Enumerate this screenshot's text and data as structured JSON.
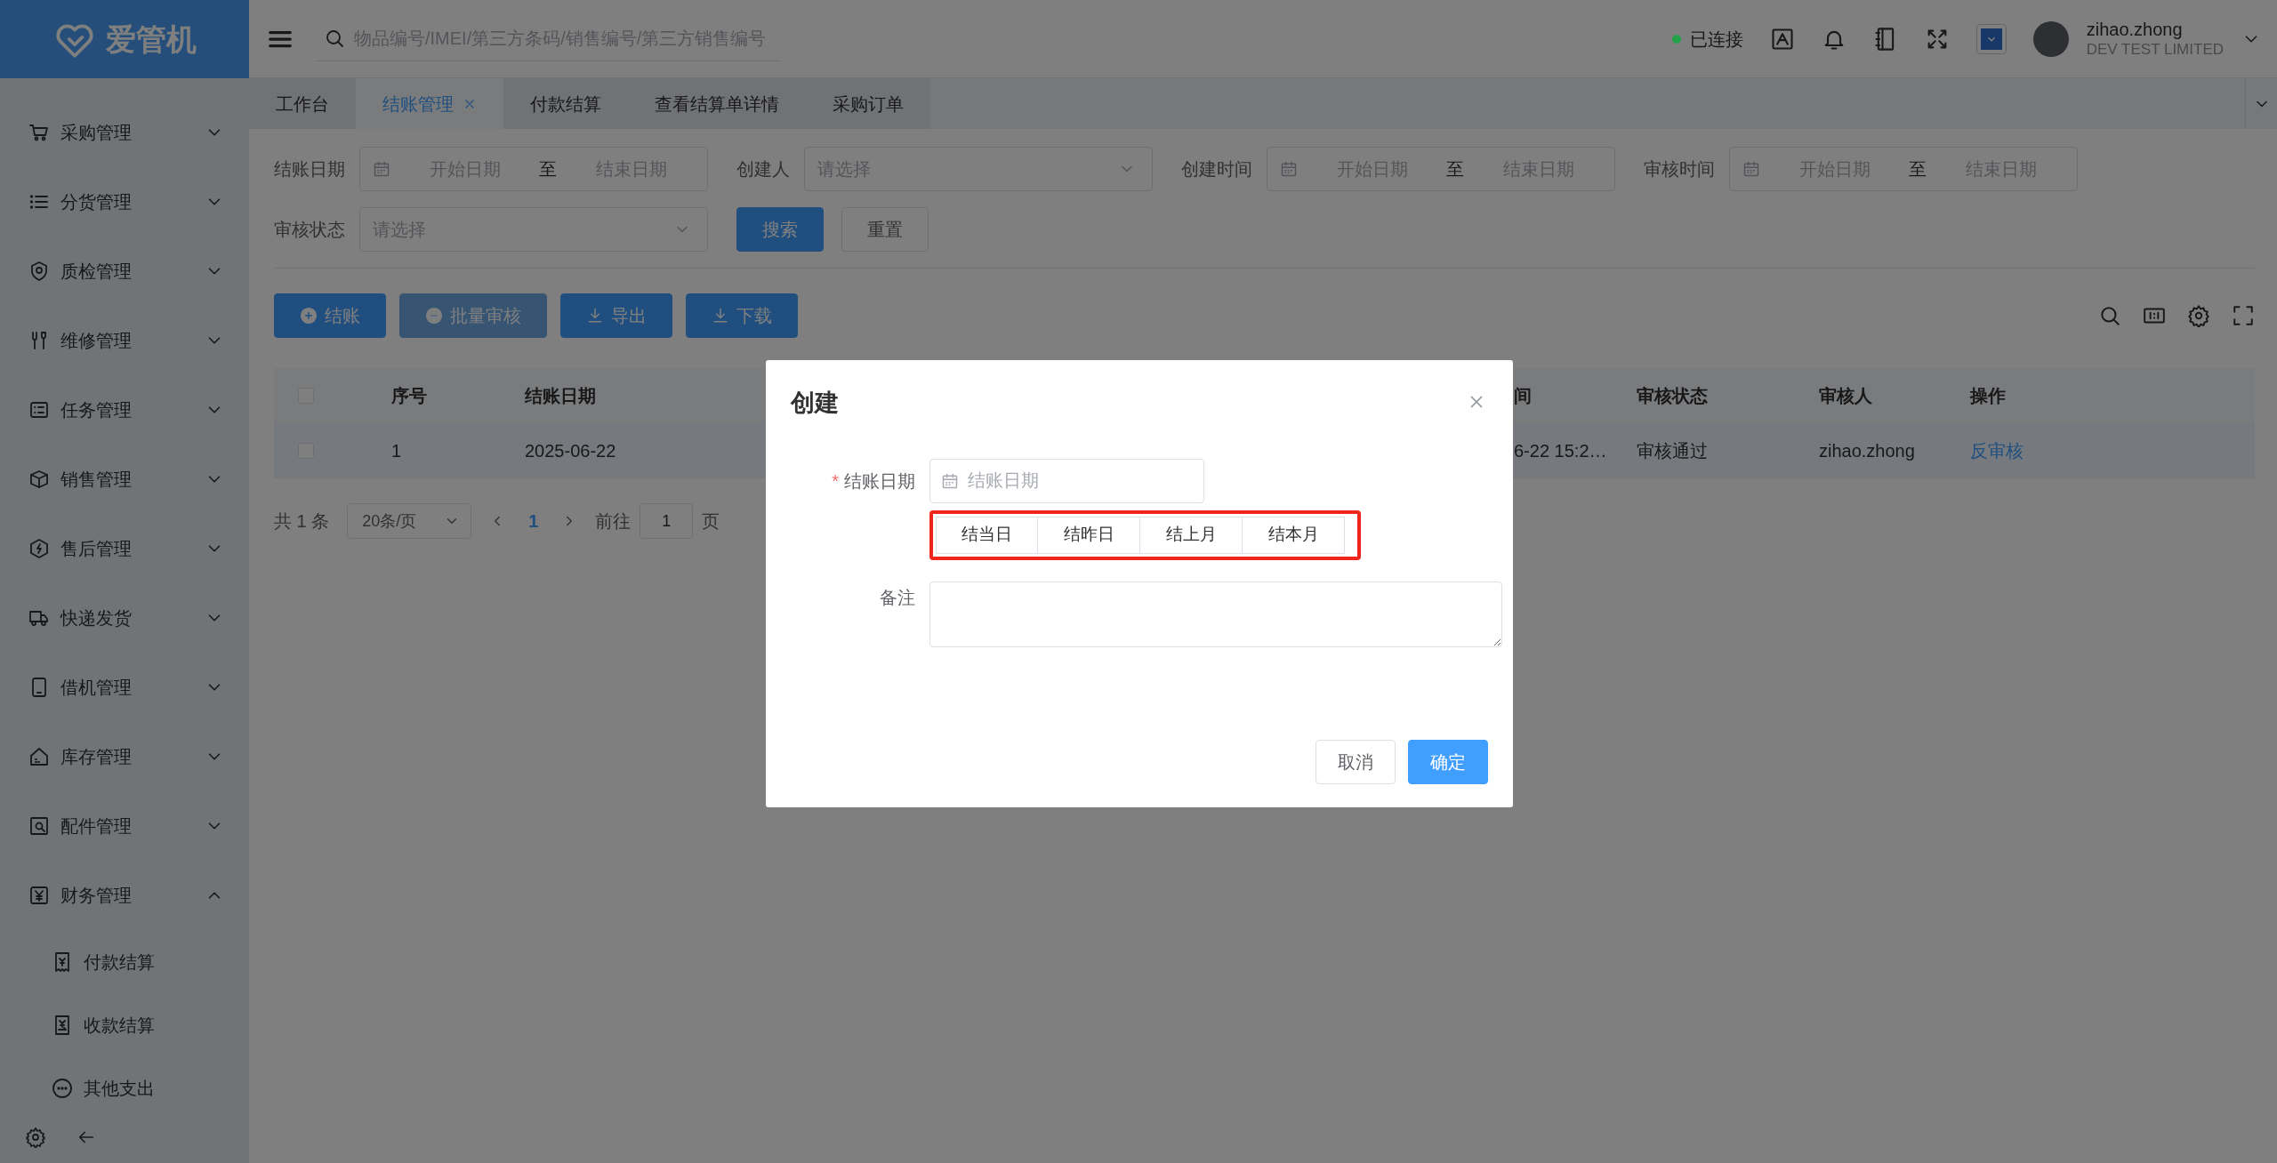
{
  "app": {
    "logo": "爱管机"
  },
  "header": {
    "search_placeholder": "物品编号/IMEI/第三方条码/销售编号/第三方销售编号",
    "connection": {
      "label": "已连接",
      "color": "#22a34a"
    },
    "user": {
      "name": "zihao.zhong",
      "company": "DEV TEST LIMITED"
    }
  },
  "sidebar": {
    "items": [
      {
        "label": "采购管理",
        "expanded": false
      },
      {
        "label": "分货管理",
        "expanded": false
      },
      {
        "label": "质检管理",
        "expanded": false
      },
      {
        "label": "维修管理",
        "expanded": false
      },
      {
        "label": "任务管理",
        "expanded": false
      },
      {
        "label": "销售管理",
        "expanded": false
      },
      {
        "label": "售后管理",
        "expanded": false
      },
      {
        "label": "快递发货",
        "expanded": false
      },
      {
        "label": "借机管理",
        "expanded": false
      },
      {
        "label": "库存管理",
        "expanded": false
      },
      {
        "label": "配件管理",
        "expanded": false
      },
      {
        "label": "财务管理",
        "expanded": true,
        "children": [
          {
            "label": "付款结算"
          },
          {
            "label": "收款结算"
          },
          {
            "label": "其他支出"
          }
        ]
      }
    ]
  },
  "tabs": [
    {
      "label": "工作台",
      "selected": false,
      "closable": false
    },
    {
      "label": "结账管理",
      "selected": true,
      "closable": true
    },
    {
      "label": "付款结算",
      "selected": false,
      "closable": false
    },
    {
      "label": "查看结算单详情",
      "selected": false,
      "closable": false
    },
    {
      "label": "采购订单",
      "selected": false,
      "closable": false
    }
  ],
  "filters": [
    {
      "label": "结账日期",
      "kind": "daterange",
      "start_placeholder": "开始日期",
      "separator": "至",
      "end_placeholder": "结束日期"
    },
    {
      "label": "创建人",
      "kind": "select",
      "placeholder": "请选择"
    },
    {
      "label": "创建时间",
      "kind": "daterange",
      "start_placeholder": "开始日期",
      "separator": "至",
      "end_placeholder": "结束日期"
    },
    {
      "label": "审核时间",
      "kind": "daterange",
      "start_placeholder": "开始日期",
      "separator": "至",
      "end_placeholder": "结束日期"
    },
    {
      "label": "审核状态",
      "kind": "select",
      "placeholder": "请选择"
    }
  ],
  "filter_buttons": [
    {
      "label": "搜索",
      "kind": "primary"
    },
    {
      "label": "重置",
      "kind": "default"
    }
  ],
  "toolbar": [
    {
      "label": "结账",
      "kind": "add",
      "disabled": false
    },
    {
      "label": "批量审核",
      "kind": "approve",
      "disabled": true
    },
    {
      "label": "导出",
      "kind": "download",
      "disabled": false
    },
    {
      "label": "下载",
      "kind": "download",
      "disabled": false
    }
  ],
  "table": {
    "header_checked": false,
    "columns": [
      "序号",
      "结账日期",
      "间",
      "审核状态",
      "审核人",
      "操作"
    ],
    "rows": [
      {
        "checked": false,
        "cells": [
          "1",
          "2025-06-22",
          "6-22 15:2…",
          "审核通过",
          "zihao.zhong",
          "反审核"
        ]
      }
    ]
  },
  "pagination": {
    "total": "共 1 条",
    "page_size": "20条/页",
    "pages": [
      {
        "label": "1",
        "selected": true
      }
    ],
    "goto_label": "前往",
    "goto_value": "1",
    "goto_suffix": "页"
  },
  "dialog": {
    "title": "创建",
    "date_field": {
      "label": "结账日期",
      "required_mark": "*",
      "placeholder": "结账日期"
    },
    "quick_dates": {
      "highlighted": true,
      "buttons": [
        "结当日",
        "结昨日",
        "结上月",
        "结本月"
      ]
    },
    "remark": {
      "label": "备注"
    },
    "buttons": [
      {
        "label": "取消",
        "kind": "default"
      },
      {
        "label": "确定",
        "kind": "primary"
      }
    ]
  }
}
